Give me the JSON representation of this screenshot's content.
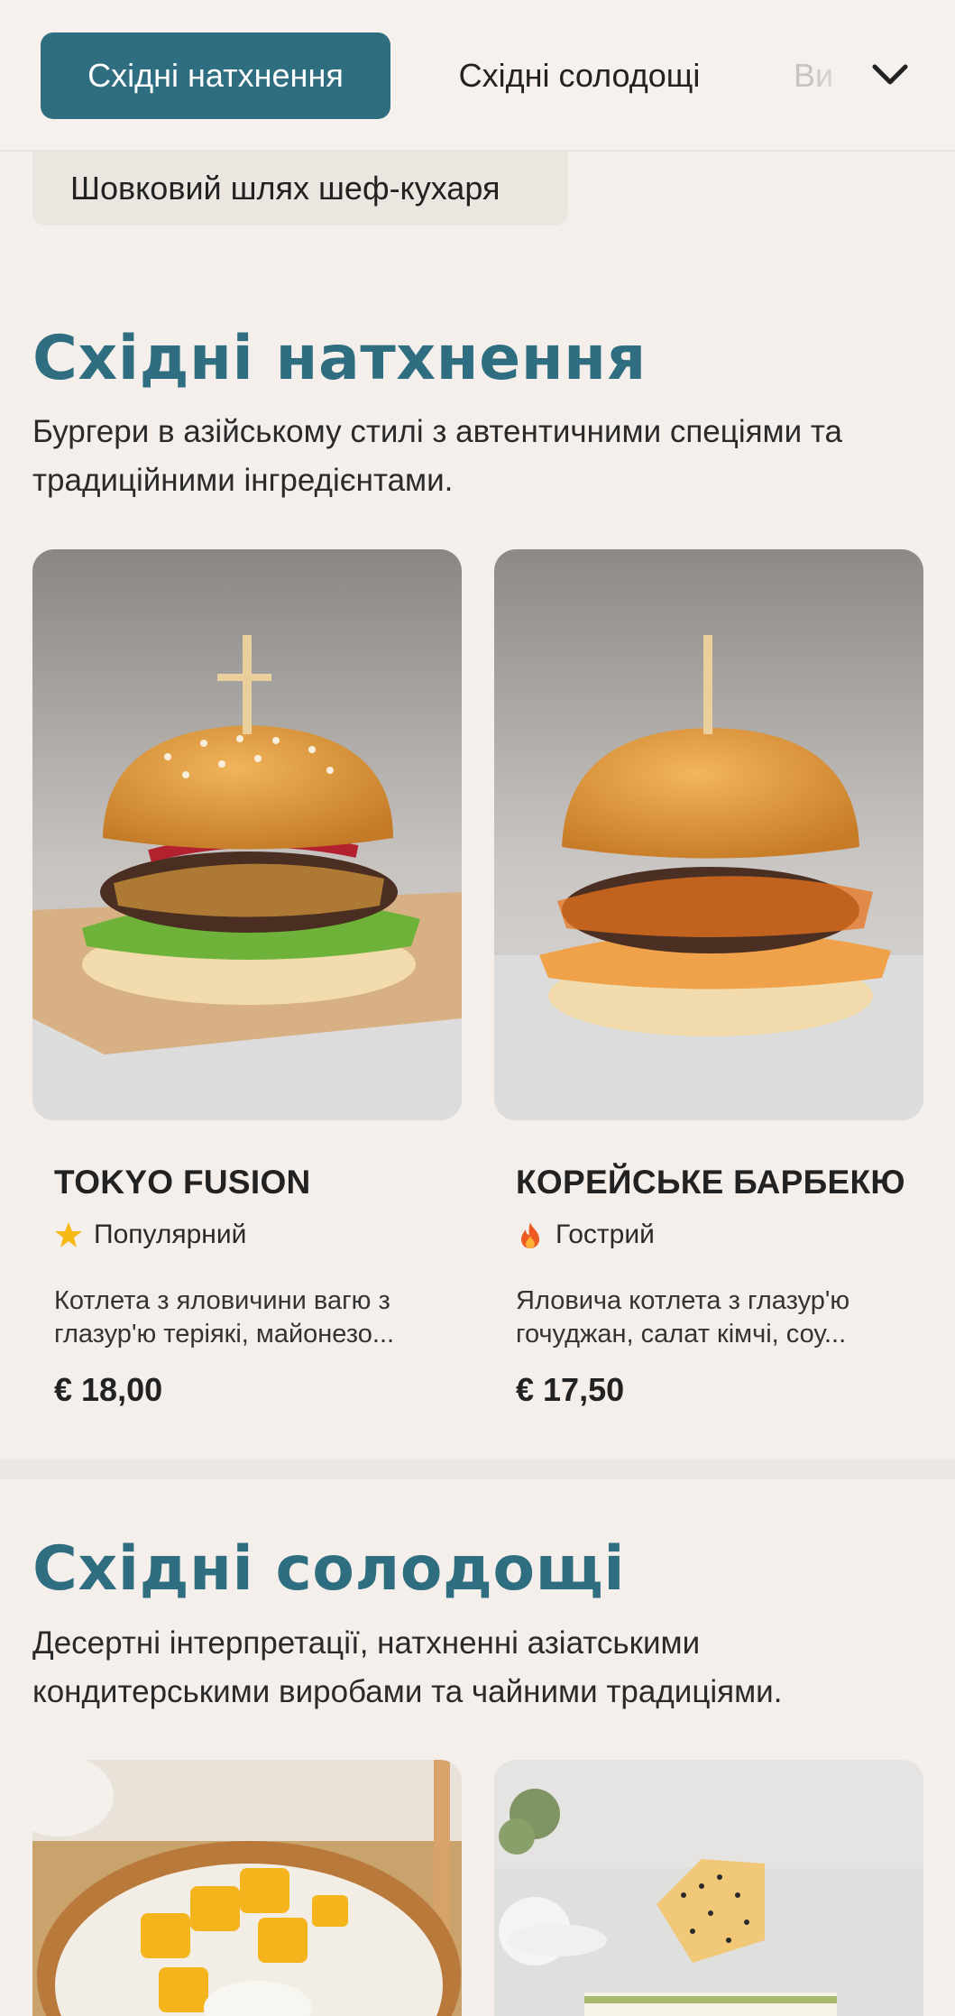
{
  "nav": {
    "tabs": [
      {
        "label": "Східні натхнення",
        "active": true
      },
      {
        "label": "Східні солодощі",
        "active": false
      },
      {
        "label": "Ви",
        "active": false
      }
    ],
    "subtab_label": "Шовковий шлях шеф-кухаря",
    "accent_color": "#2f6e80",
    "expand_icon": "chevron-down-icon"
  },
  "sections": [
    {
      "title": "Східні натхнення",
      "description": "Бургери в азійському стилі з автентичними спеціями та традиційними інгредієнтами.",
      "items": [
        {
          "name": "TOKYO FUSION",
          "tag": "Популярний",
          "tag_icon": "star-icon",
          "description": "Котлета з яловичини вагю з глазур'ю теріякі, майонезо...",
          "price": "€ 18,00"
        },
        {
          "name": "КОРЕЙСЬКЕ БАРБЕКЮ",
          "tag": "Гострий",
          "tag_icon": "fire-icon",
          "description": "Яловича котлета з глазур'ю гочуджан, салат кімчі, соу...",
          "price": "€ 17,50"
        }
      ]
    },
    {
      "title": "Східні солодощі",
      "description": "Десертні інтерпретації, натхненні азіатськими кондитерськими виробами та чайними традиціями."
    }
  ]
}
